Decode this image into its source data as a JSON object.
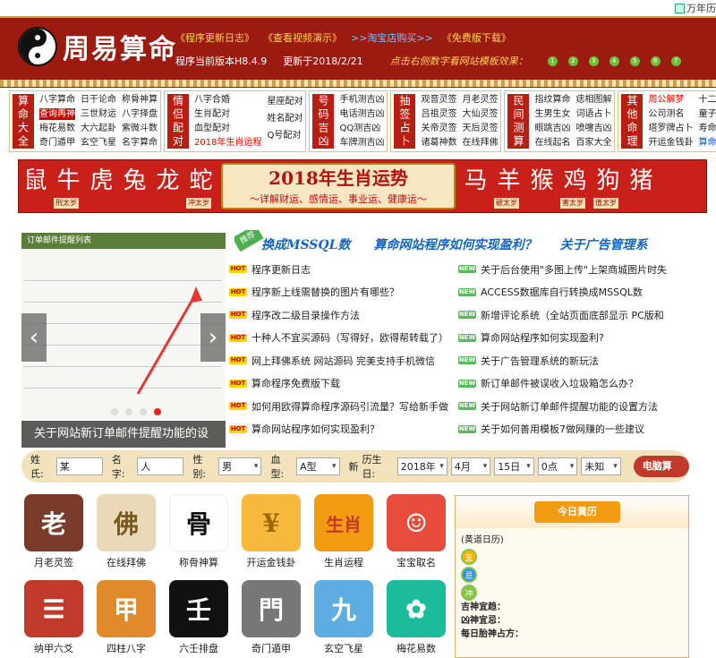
{
  "topbar": {
    "wannianli": "万年历"
  },
  "header": {
    "site_name": "周易算命",
    "links": [
      "《程序更新日志》",
      "《查看视频演示》",
      ">>淘宝店购买>>",
      "《免费版下载》"
    ],
    "version": "程序当前版本H8.4.9",
    "updated": "更新于2018/2/21",
    "tip": "点击右侧数字看网站模板效果：",
    "theme_numbers": [
      "1",
      "2",
      "3",
      "4",
      "5",
      "6",
      "7"
    ]
  },
  "nav": [
    {
      "title": "算命大全",
      "cols": [
        [
          "八字算命",
          "查询再神",
          "梅花易数",
          "奇门遁甲"
        ],
        [
          "日干论命",
          "三世财运",
          "大六起卦",
          "玄空飞星"
        ],
        [
          "称骨神算",
          "八字择盘",
          "紫微斗数",
          "名字算命"
        ]
      ]
    },
    {
      "title": "情侣配对",
      "cols": [
        [
          "八字合婚",
          "生肖配对",
          "血型配对",
          "2018年生肖运程"
        ],
        [
          "星座配对",
          "姓名配对",
          "Q号配对",
          ""
        ]
      ]
    },
    {
      "title": "号码吉凶",
      "cols": [
        [
          "手机测吉凶",
          "电话测吉凶",
          "QQ测吉凶",
          "车牌测吉凶"
        ]
      ]
    },
    {
      "title": "抽签占卜",
      "cols": [
        [
          "观音灵签",
          "吕祖灵签",
          "关帝灵签",
          "诸葛神数"
        ],
        [
          "月老灵签",
          "大仙灵签",
          "天后灵签",
          "在线拜佛"
        ]
      ]
    },
    {
      "title": "民间测算",
      "cols": [
        [
          "指纹算命",
          "生男生女",
          "眼跳吉凶",
          "在线起名"
        ],
        [
          "痣相图解",
          "词语占卜",
          "喷嚏吉凶",
          "百家大全"
        ]
      ]
    },
    {
      "title": "其他命理",
      "cols": [
        [
          "周公解梦",
          "公司测名",
          "塔罗牌占卜",
          "开运金钱卦"
        ],
        [
          "十二星座",
          "童子命查询",
          "寿命测算",
          "算命大全"
        ]
      ]
    }
  ],
  "banner": {
    "left_animals": [
      "鼠",
      "牛",
      "虎",
      "兔",
      "龙",
      "蛇"
    ],
    "right_animals": [
      "马",
      "羊",
      "猴",
      "鸡",
      "狗",
      "猪"
    ],
    "title": "2018年生肖运势",
    "subtitle": "～详解财运、感情运、事业运、健康运～",
    "tags": {
      "牛": "刑太岁",
      "蛇": "冲太岁",
      "羊": "破太岁",
      "鸡": "害太岁",
      "狗": "值太岁"
    }
  },
  "slider": {
    "caption": "关于网站新订单邮件提醒功能的设",
    "header": "订单邮件提醒列表"
  },
  "marquee": {
    "badge": "推荐",
    "items": [
      "换成MSSQL数",
      "算命网站程序如何实现盈利？",
      "关于广告管理系"
    ]
  },
  "news_left": [
    {
      "tag": "HOT",
      "text": "程序更新日志"
    },
    {
      "tag": "HOT",
      "text": "程序新上线需替换的图片有哪些？"
    },
    {
      "tag": "HOT",
      "text": "程序改二级目录操作方法"
    },
    {
      "tag": "HOT",
      "text": "十种人不宜买源码（写得好，欧得帮转载了）"
    },
    {
      "tag": "HOT",
      "text": "网上拜佛系统 网站源码 完美支持手机微信"
    },
    {
      "tag": "HOT",
      "text": "算命程序免费版下载"
    },
    {
      "tag": "HOT",
      "text": "如何用欧得算命程序源码引流量？写给新手做"
    },
    {
      "tag": "HOT",
      "text": "算命网站程序如何实现盈利？"
    }
  ],
  "news_right": [
    {
      "tag": "NEW",
      "text": "关于后台使用\"多图上传\"上架商城图片时失"
    },
    {
      "tag": "NEW",
      "text": "ACCESS数据库自行转换成MSSQL数"
    },
    {
      "tag": "NEW",
      "text": "新增评论系统（全站页面底部显示 PC版和"
    },
    {
      "tag": "NEW",
      "text": "算命网站程序如何实现盈利?"
    },
    {
      "tag": "NEW",
      "text": "关于广告管理系统的新玩法"
    },
    {
      "tag": "NEW",
      "text": "新订单邮件被误收入垃圾箱怎么办？"
    },
    {
      "tag": "NEW",
      "text": "关于网站新订单邮件提醒功能的设置方法"
    },
    {
      "tag": "NEW",
      "text": "关于如何善用模板7做网赚的一些建议"
    }
  ],
  "form": {
    "labels": [
      "姓氏:",
      "名字:",
      "性别:",
      "血型:",
      "历生日:"
    ],
    "xing_val": "某",
    "ming_val": "人",
    "gender": "男",
    "blood": "A型",
    "calendar": "新",
    "year": "2018年",
    "month": "4月",
    "day": "15日",
    "hour": "0点",
    "unknown": "未知",
    "submit": "电脑算命"
  },
  "apps": [
    {
      "label": "月老灵签",
      "glyph": "老",
      "bg": "#7b3b2a",
      "fg": "#fff"
    },
    {
      "label": "在线拜佛",
      "glyph": "佛",
      "bg": "#e9d9b8",
      "fg": "#7a5a20"
    },
    {
      "label": "称骨神算",
      "glyph": "骨",
      "bg": "#ffffff",
      "fg": "#111"
    },
    {
      "label": "开运金钱卦",
      "glyph": "¥",
      "bg": "#f6b93b",
      "fg": "#a06500"
    },
    {
      "label": "生肖运程",
      "glyph": "生肖",
      "bg": "#f39c12",
      "fg": "#c0392b"
    },
    {
      "label": "宝宝取名",
      "glyph": "☺",
      "bg": "#e74c3c",
      "fg": "#fff"
    },
    {
      "label": "纳甲六爻",
      "glyph": "☰",
      "bg": "#c0392b",
      "fg": "#fff"
    },
    {
      "label": "四柱八字",
      "glyph": "甲",
      "bg": "#e08a2c",
      "fg": "#fff"
    },
    {
      "label": "六壬排盘",
      "glyph": "壬",
      "bg": "#111111",
      "fg": "#fff"
    },
    {
      "label": "奇门遁甲",
      "glyph": "門",
      "bg": "#777777",
      "fg": "#fff"
    },
    {
      "label": "玄空飞星",
      "glyph": "九",
      "bg": "#5dade2",
      "fg": "#fff"
    },
    {
      "label": "梅花易数",
      "glyph": "✿",
      "bg": "#1abc9c",
      "fg": "#fff"
    }
  ],
  "calendar_panel": {
    "title": "今日黄历",
    "huangdao": "(黄道日历)",
    "bubbles": [
      "宜",
      "忌",
      "冲"
    ],
    "lines": [
      "吉神宜趋：",
      "凶神宜忌：",
      "每日胎神占方："
    ]
  }
}
